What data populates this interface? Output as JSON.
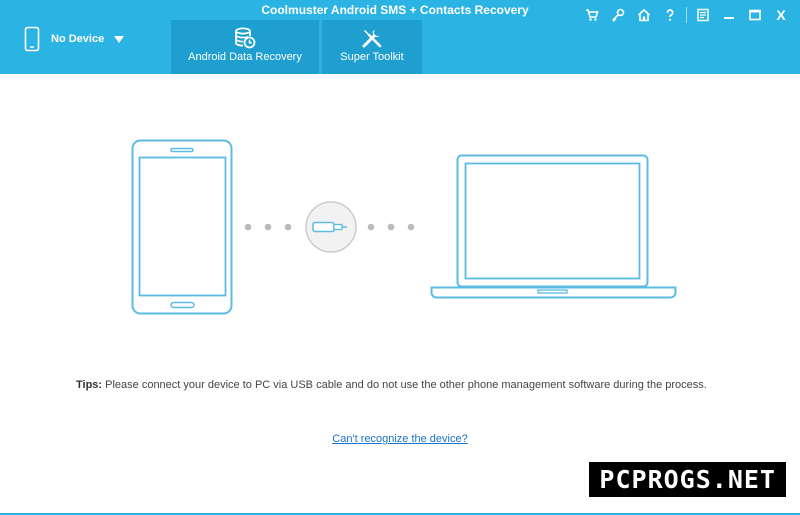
{
  "window": {
    "title": "Coolmuster Android SMS + Contacts Recovery"
  },
  "device_selector": {
    "label": "No Device"
  },
  "tabs": [
    {
      "label": "Android Data Recovery",
      "icon": "database-icon"
    },
    {
      "label": "Super Toolkit",
      "icon": "tools-icon"
    }
  ],
  "title_bar_buttons": [
    {
      "name": "cart-icon"
    },
    {
      "name": "key-icon"
    },
    {
      "name": "home-icon"
    },
    {
      "name": "help-icon"
    },
    {
      "name": "feedback-icon"
    },
    {
      "name": "minimize-icon"
    },
    {
      "name": "maximize-icon"
    },
    {
      "name": "close-icon",
      "label": "X"
    }
  ],
  "tips": {
    "prefix": "Tips:",
    "text": " Please connect your device to PC via USB cable and do not use the other phone management software during the process."
  },
  "help_link": "Can't recognize the device?",
  "watermark": "PCPROGS.NET",
  "colors": {
    "header": "#2bb3e3",
    "tab_active": "#1f9fcf",
    "illustration": "#5bbbe3",
    "link": "#1a73c8"
  }
}
